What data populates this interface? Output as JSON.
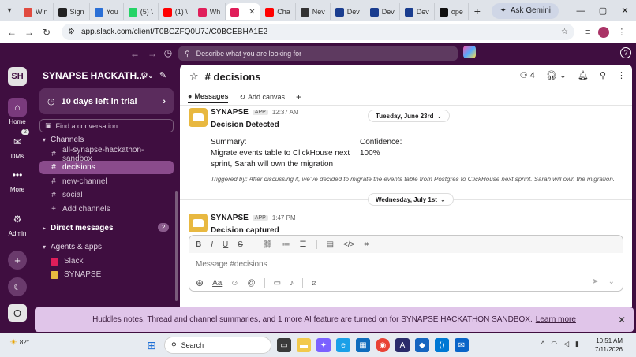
{
  "browser": {
    "tabs": [
      {
        "label": "Win",
        "color": "#e04a3f"
      },
      {
        "label": "Sign",
        "color": "#222222"
      },
      {
        "label": "You",
        "color": "#2a6fd6"
      },
      {
        "label": "(5) \\",
        "color": "#25d366"
      },
      {
        "label": "(1) \\",
        "color": "#ff0000"
      },
      {
        "label": "Wh",
        "color": "#e01e5a"
      },
      {
        "label": "",
        "color": "#e01e5a",
        "active": true
      },
      {
        "label": "Cha",
        "color": "#ff0000"
      },
      {
        "label": "Nev",
        "color": "#333333"
      },
      {
        "label": "Dev",
        "color": "#1a3d8f"
      },
      {
        "label": "Dev",
        "color": "#1a3d8f"
      },
      {
        "label": "Dev",
        "color": "#1a3d8f"
      },
      {
        "label": "ope",
        "color": "#111111"
      }
    ],
    "ask_gemini": "Ask Gemini",
    "url": "app.slack.com/client/T0BCZFQ0U7J/C0BCEBHA1E2"
  },
  "slack": {
    "search_placeholder": "Describe what you are looking for",
    "workspace_initials": "SH",
    "workspace_name": "SYNAPSE HACKATH...",
    "trial_label": "10 days left in trial",
    "find_placeholder": "Find a conversation...",
    "rail": {
      "home": "Home",
      "dms": "DMs",
      "dm_badge": "2",
      "more": "More",
      "admin": "Admin",
      "user_initial": "O"
    },
    "channels_header": "Channels",
    "channels": [
      {
        "name": "all-synapse-hackathon-sandbox",
        "selected": false
      },
      {
        "name": "decisions",
        "selected": true
      },
      {
        "name": "new-channel",
        "selected": false
      },
      {
        "name": "social",
        "selected": false
      }
    ],
    "add_channels": "Add channels",
    "dm_header": "Direct messages",
    "dm_count": "2",
    "apps_header": "Agents & apps",
    "apps": [
      {
        "name": "Slack",
        "color": "#e01e5a"
      },
      {
        "name": "SYNAPSE",
        "color": "#e8b840"
      }
    ]
  },
  "channel": {
    "title": "# decisions",
    "member_count": "4",
    "tabs": {
      "messages": "Messages",
      "add_canvas": "Add canvas"
    }
  },
  "messages": [
    {
      "sender": "SYNAPSE",
      "app_tag": "APP",
      "time": "12:37 AM",
      "headline": "Decision Detected",
      "summary_label": "Summary:",
      "summary_text": "Migrate events table to ClickHouse next sprint, Sarah will own the migration",
      "confidence_label": "Confidence:",
      "confidence_value": "100%",
      "triggered": "Triggered by: After discussing it, we've decided to migrate the events table from Postgres to ClickHouse next sprint. Sarah will own the migration."
    },
    {
      "sender": "SYNAPSE",
      "app_tag": "APP",
      "time": "1:47 PM",
      "headline": "Decision captured"
    }
  ],
  "dates": {
    "first": "Tuesday, June 23rd",
    "second": "Wednesday, July 1st"
  },
  "composer": {
    "placeholder": "Message #decisions"
  },
  "banner": {
    "text": "Huddles notes, Thread and channel summaries, and 1 more AI feature are turned on for SYNAPSE HACKATHON SANDBOX.",
    "link": "Learn more"
  },
  "taskbar": {
    "temperature": "82°",
    "search": "Search",
    "time": "10:51 AM",
    "date": "7/11/2026"
  }
}
